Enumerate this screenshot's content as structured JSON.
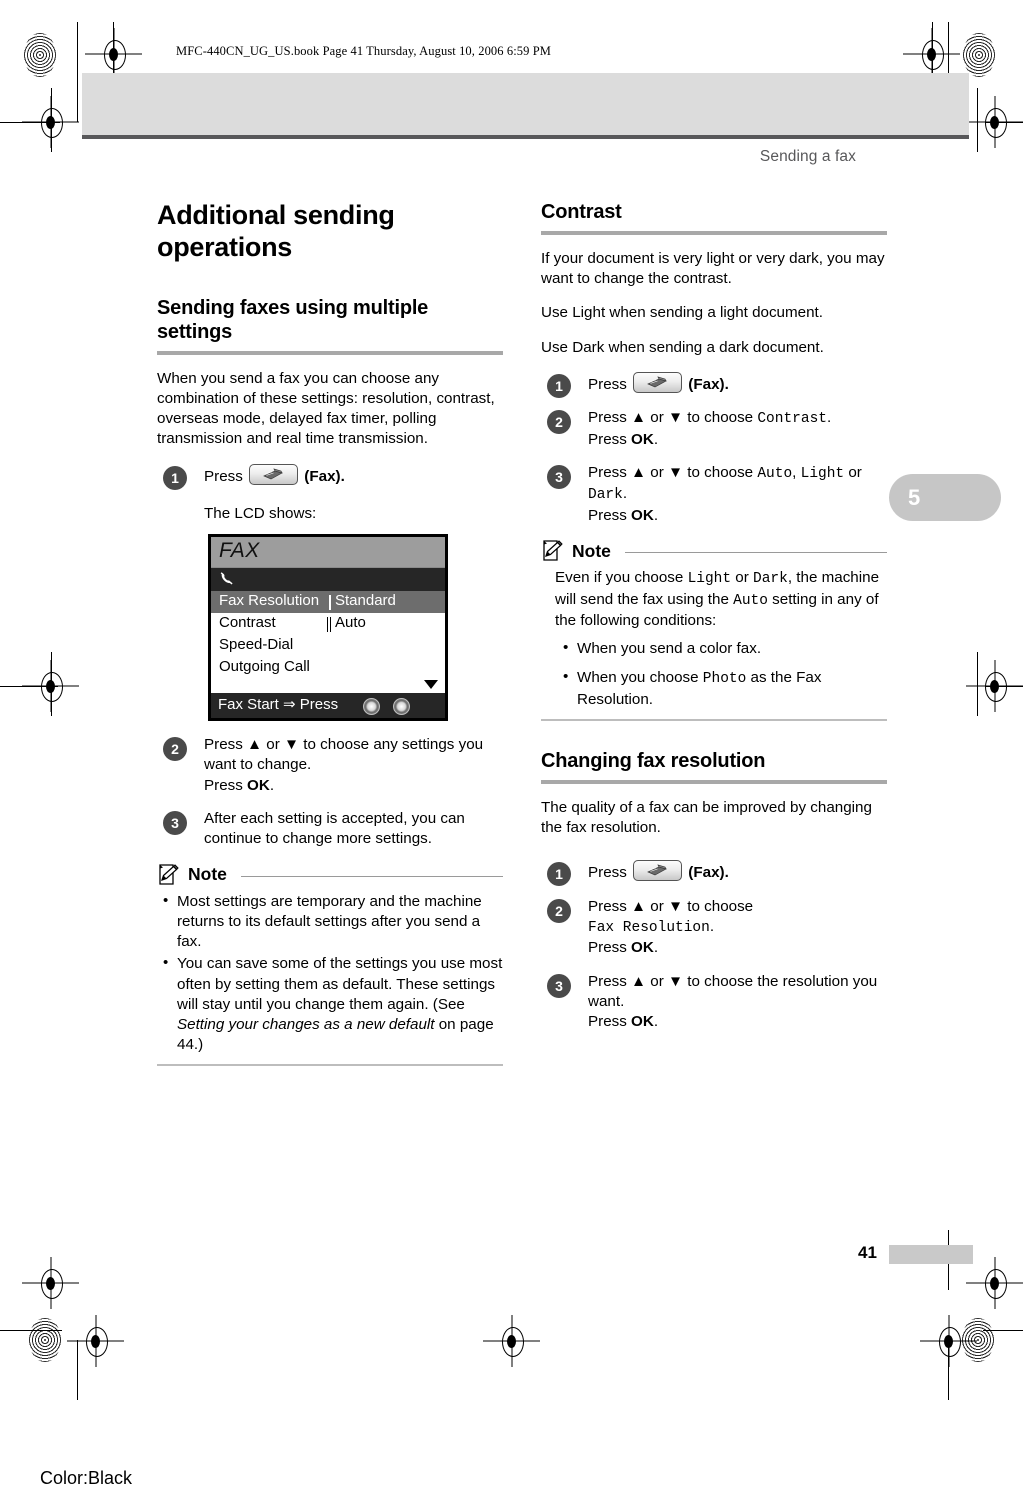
{
  "print": {
    "book_line": "MFC-440CN_UG_US.book  Page 41  Thursday, August 10, 2006  6:59 PM",
    "color_label": "Color:Black"
  },
  "header": {
    "running_head": "Sending a fax"
  },
  "chapter_tab": {
    "number": "5"
  },
  "footer": {
    "page_number": "41"
  },
  "left_column": {
    "chapter_title": "Additional sending operations",
    "section_title": "Sending faxes using multiple settings",
    "intro": "When you send a fax you can choose any combination of these settings: resolution, contrast, overseas mode, delayed fax timer, polling transmission and real time transmission.",
    "step1": {
      "num": "1",
      "text_before": "Press",
      "text_after": "(Fax).",
      "fax_label": "Fax",
      "lcd_caption": "The LCD shows:"
    },
    "lcd": {
      "title": "FAX",
      "rows": [
        {
          "label": "Fax Resolution",
          "value": "Standard",
          "selected": true
        },
        {
          "label": "Contrast",
          "value": "Auto",
          "selected": false
        },
        {
          "label": "Speed-Dial",
          "value": "",
          "selected": false
        },
        {
          "label": "Outgoing Call",
          "value": "",
          "selected": false
        }
      ],
      "footer_text": "Fax Start  ⇒  Press"
    },
    "step2": {
      "num": "2",
      "line1": "Press ▲ or ▼ to choose any settings you want to change.",
      "line2_prefix": "Press ",
      "line2_key": "OK",
      "line2_suffix": "."
    },
    "step3": {
      "num": "3",
      "text": "After each setting is accepted, you can continue to change more settings."
    },
    "note": {
      "title": "Note",
      "bullets": [
        "Most settings are temporary and the machine returns to its default settings after you send a fax.",
        "You can save some of the settings you use most often by setting them as default. These settings will stay until you change them again. (See Setting your changes as a new default on page 44.)"
      ],
      "bullet2_plain_a": "You can save some of the settings you use most often by setting them as default. These settings will stay until you change them again. (See ",
      "bullet2_italic": "Setting your changes as a new default",
      "bullet2_plain_b": " on page 44.)"
    }
  },
  "right_column": {
    "contrast": {
      "section_title": "Contrast",
      "para1": "If your document is very light or very dark, you may want to change the contrast.",
      "para2": "Use Light when sending a light document.",
      "para3": "Use Dark when sending a dark document.",
      "step1": {
        "num": "1",
        "text_before": "Press",
        "fax_label": "Fax",
        "text_after": "(Fax)."
      },
      "step2": {
        "num": "2",
        "prefix": "Press ▲ or ▼ to choose ",
        "mono": "Contrast",
        "suffix": ".",
        "ok_prefix": "Press ",
        "ok": "OK",
        "ok_suffix": "."
      },
      "step3": {
        "num": "3",
        "prefix": "Press ▲ or ▼ to choose ",
        "mono1": "Auto",
        "mid1": ", ",
        "mono2": "Light",
        "mid2": " or ",
        "mono3": "Dark",
        "suffix": ".",
        "ok_prefix": "Press ",
        "ok": "OK",
        "ok_suffix": "."
      },
      "note": {
        "title": "Note",
        "body_a": "Even if you choose ",
        "body_mono1": "Light",
        "body_b": " or ",
        "body_mono2": "Dark",
        "body_c": ", the machine will send the fax using the ",
        "body_mono3": "Auto",
        "body_d": " setting in any of the following conditions:",
        "bullet1": "When you send a color fax.",
        "bullet2_a": "When you choose ",
        "bullet2_mono": "Photo",
        "bullet2_b": " as the Fax Resolution."
      }
    },
    "resolution": {
      "section_title": "Changing fax resolution",
      "para1": "The quality of a fax can be improved by changing the fax resolution.",
      "step1": {
        "num": "1",
        "text_before": "Press",
        "fax_label": "Fax",
        "text_after": "(Fax)."
      },
      "step2": {
        "num": "2",
        "prefix": "Press ▲ or ▼ to choose",
        "mono": "Fax Resolution",
        "suffix": ".",
        "ok_prefix": "Press ",
        "ok": "OK",
        "ok_suffix": "."
      },
      "step3": {
        "num": "3",
        "text": "Press ▲ or ▼ to choose the resolution you want.",
        "ok_prefix": "Press ",
        "ok": "OK",
        "ok_suffix": "."
      }
    }
  },
  "colors": {
    "rule": "#a8a8a8",
    "header_band": "#dcdcdc",
    "header_border": "#58585a",
    "step_circle": "#4a4a4a",
    "chapter_tab": "#c6c6c6",
    "lcd_selected_row": "#6d6d6d",
    "lcd_title_bar": "#9d9d9d",
    "lcd_dark_bar": "#262626"
  }
}
